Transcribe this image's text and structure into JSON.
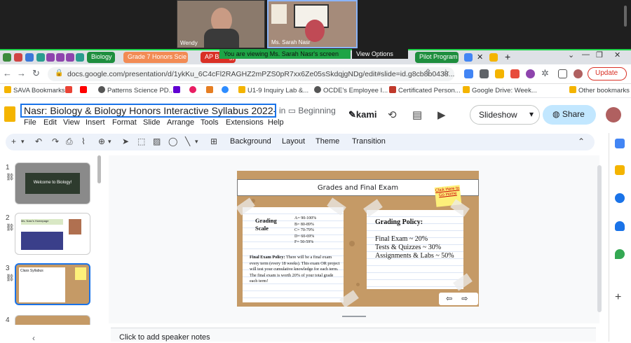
{
  "meet": {
    "participants": [
      {
        "name": "Wendy"
      },
      {
        "name": "Ms. Sarah Nasr"
      }
    ],
    "banner": "You are viewing Ms. Sarah Nasr's screen",
    "view_options": "View Options"
  },
  "browser_tabs": {
    "tabs": [
      "Biology",
      "Grade 7 Honors Scie",
      "AP Biology",
      "Pilot Program"
    ]
  },
  "address": {
    "url": "docs.google.com/presentation/d/1ykKu_6C4cFl2RAGHZ2mPZS0pR7xx6Ze05sSkdqjgNDg/edit#slide=id.g8cb8b0438...",
    "update_label": "Update"
  },
  "bookmarks": [
    "SAVA Bookmarks",
    "Patterns Science PD...",
    "U1-9 Inquiry Lab &...",
    "OCDE's Employee I...",
    "Certificated Person...",
    "Google Drive: Week...",
    "Other bookmarks"
  ],
  "doc": {
    "title": "Nasr: Biology & Biology Honors Interactive Syllabus 2022-23 SA",
    "folder_prefix": "in",
    "folder": "Beginning",
    "menus": [
      "File",
      "Edit",
      "View",
      "Insert",
      "Format",
      "Slide",
      "Arrange",
      "Tools",
      "Extensions",
      "Help"
    ],
    "kami_label": "kami",
    "slideshow_label": "Slideshow",
    "share_label": "Share"
  },
  "toolbar": {
    "background": "Background",
    "layout": "Layout",
    "theme": "Theme",
    "transition": "Transition"
  },
  "filmstrip": {
    "numbers": [
      "1",
      "2",
      "3",
      "4"
    ],
    "thumb1_title": "Welcome to Biology!",
    "thumb2_title": "Ms. Nasr's Homepage",
    "thumb3_title": "Class Syllabus"
  },
  "slide": {
    "heading": "Grades and Final Exam",
    "sticky_note": "Click Here to Go Home",
    "grading_scale_label": "Grading Scale",
    "grades": [
      "A= 90-100%",
      "B= 80-89%",
      "C= 70-79%",
      "D= 60-69%",
      "F= 50-59%"
    ],
    "final_exam_title": "Final Exam Policy:",
    "final_exam_text": "There will be a final exam every term (every 18 weeks). This exam OR project will test your cumulative knowledge for each term. The final exam is worth 20% of your total grade each term!",
    "grading_policy_title": "Grading Policy:",
    "grading_policy_items": [
      "Final Exam ~ 20%",
      "Tests & Quizzes ~ 30%",
      "Assignments & Labs ~ 50%"
    ],
    "nav_prev": "⇦",
    "nav_next": "⇨"
  },
  "speaker_notes": {
    "placeholder": "Click to add speaker notes"
  }
}
